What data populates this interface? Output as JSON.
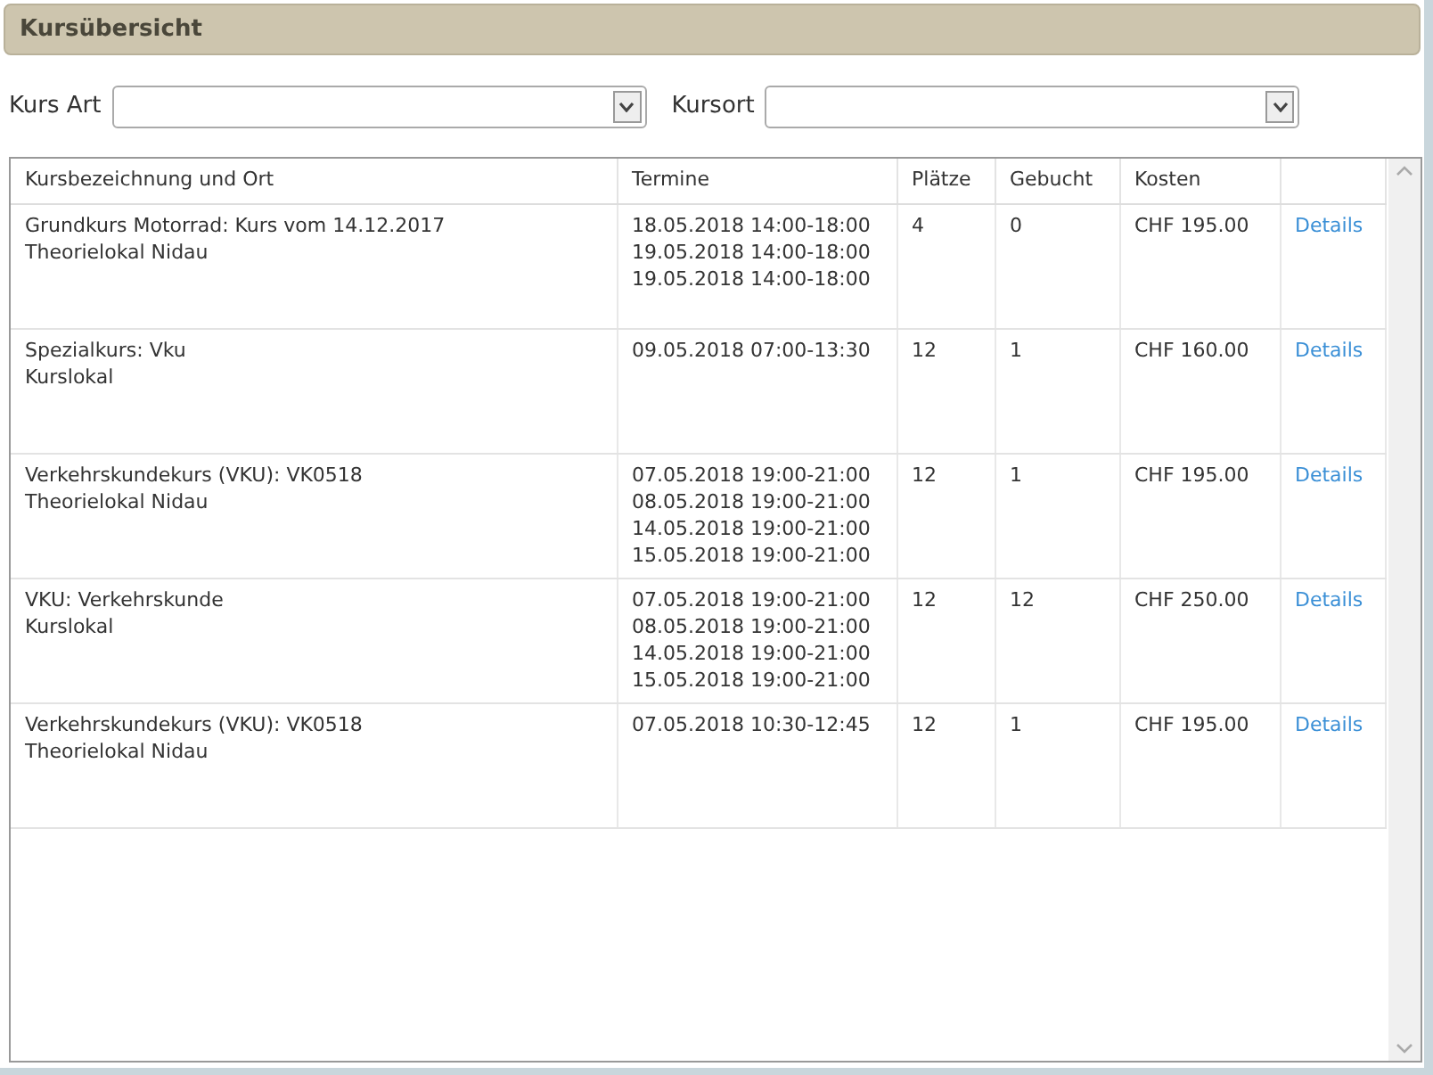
{
  "header": {
    "title": "Kursübersicht"
  },
  "filters": [
    {
      "label": "Kurs Art"
    },
    {
      "label": "Kursort"
    }
  ],
  "table": {
    "columns": [
      "Kursbezeichnung und Ort",
      "Termine",
      "Plätze",
      "Gebucht",
      "Kosten"
    ],
    "rows": [
      {
        "name": "Grundkurs Motorrad: Kurs vom 14.12.2017",
        "place": "Theorielokal Nidau",
        "dates": [
          "18.05.2018 14:00-18:00",
          "19.05.2018 14:00-18:00",
          "19.05.2018 14:00-18:00"
        ],
        "seats": "4",
        "booked": "0",
        "cost": "CHF 195.00",
        "link": "Details"
      },
      {
        "name": "Spezialkurs: Vku",
        "place": "Kurslokal",
        "dates": [
          "09.05.2018 07:00-13:30"
        ],
        "seats": "12",
        "booked": "1",
        "cost": "CHF 160.00",
        "link": "Details"
      },
      {
        "name": "Verkehrskundekurs (VKU): VK0518",
        "place": "Theorielokal Nidau",
        "dates": [
          "07.05.2018 19:00-21:00",
          "08.05.2018 19:00-21:00",
          "14.05.2018 19:00-21:00",
          "15.05.2018 19:00-21:00"
        ],
        "seats": "12",
        "booked": "1",
        "cost": "CHF 195.00",
        "link": "Details"
      },
      {
        "name": "VKU: Verkehrskunde",
        "place": "Kurslokal",
        "dates": [
          "07.05.2018 19:00-21:00",
          "08.05.2018 19:00-21:00",
          "14.05.2018 19:00-21:00",
          "15.05.2018 19:00-21:00"
        ],
        "seats": "12",
        "booked": "12",
        "cost": "CHF 250.00",
        "link": "Details"
      },
      {
        "name": "Verkehrskundekurs (VKU): VK0518",
        "place": "Theorielokal Nidau",
        "dates": [
          "07.05.2018 10:30-12:45"
        ],
        "seats": "12",
        "booked": "1",
        "cost": "CHF 195.00",
        "link": "Details"
      }
    ]
  }
}
